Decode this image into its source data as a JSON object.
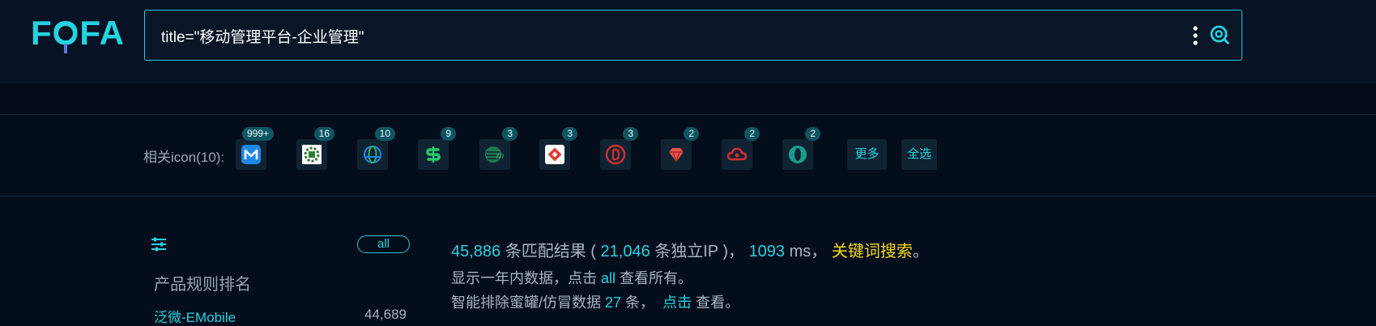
{
  "logo": {
    "text": "FOFA"
  },
  "search": {
    "query": "title=\"移动管理平台-企业管理\""
  },
  "icons_section": {
    "label": "相关icon(10):",
    "icons": [
      {
        "name": "mobile-m-logo-icon",
        "count": "999+",
        "color": "#1e88e5"
      },
      {
        "name": "green-seal-logo-icon",
        "count": "16",
        "color": "#2e7d32"
      },
      {
        "name": "blue-globe-logo-icon",
        "count": "10",
        "color": "#1e88e5"
      },
      {
        "name": "green-dollar-logo-icon",
        "count": "9",
        "color": "#28c76f"
      },
      {
        "name": "green-sphere-logo-icon",
        "count": "3",
        "color": "#2fb06b"
      },
      {
        "name": "red-square-logo-icon",
        "count": "3",
        "color": "#e53935"
      },
      {
        "name": "red-d-circle-logo-icon",
        "count": "3",
        "color": "#d32f2f"
      },
      {
        "name": "red-gem-logo-icon",
        "count": "2",
        "color": "#e5534b"
      },
      {
        "name": "red-cloud-logo-icon",
        "count": "2",
        "color": "#d32f2f"
      },
      {
        "name": "teal-o-circle-logo-icon",
        "count": "2",
        "color": "#1a9c8c"
      }
    ],
    "more_label": "更多",
    "select_all_label": "全选"
  },
  "sidebar": {
    "all_label": "all",
    "rank_title": "产品规则排名",
    "items": [
      {
        "name": "泛微-EMobile",
        "count": "44,689"
      }
    ]
  },
  "results": {
    "total": "45,886",
    "total_suffix": " 条匹配结果 ( ",
    "unique_ip": "21,046",
    "unique_ip_suffix": " 条独立IP )， ",
    "time": "1093",
    "time_suffix": " ms， ",
    "keyword_link": "关键词搜索",
    "end_mark": "。",
    "line2_prefix": "显示一年内数据，点击 ",
    "line2_link": "all",
    "line2_suffix": " 查看所有。",
    "line3_prefix": "智能排除蜜罐/仿冒数据 ",
    "line3_count": "27",
    "line3_mid": " 条，",
    "line3_link": "点击",
    "line3_suffix": " 查看。"
  },
  "colors": {
    "accent": "#25d4e0",
    "highlight": "#f2d61b",
    "background": "#040d1c"
  }
}
